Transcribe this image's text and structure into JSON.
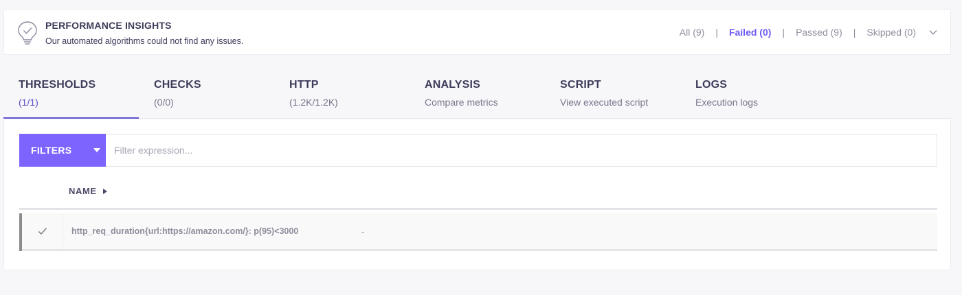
{
  "insights": {
    "title": "PERFORMANCE INSIGHTS",
    "subtitle": "Our automated algorithms could not find any issues.",
    "filters": [
      {
        "label": "All (9)",
        "active": false
      },
      {
        "label": "Failed (0)",
        "active": true
      },
      {
        "label": "Passed (9)",
        "active": false
      },
      {
        "label": "Skipped (0)",
        "active": false
      }
    ],
    "separator": "|",
    "icon": "lightbulb-check-icon",
    "expand_icon": "chevron-down-icon"
  },
  "tabs": [
    {
      "title": "THRESHOLDS",
      "sub": "(1/1)",
      "active": true
    },
    {
      "title": "CHECKS",
      "sub": "(0/0)",
      "active": false
    },
    {
      "title": "HTTP",
      "sub": "(1.2K/1.2K)",
      "active": false
    },
    {
      "title": "ANALYSIS",
      "sub": "Compare metrics",
      "active": false
    },
    {
      "title": "SCRIPT",
      "sub": "View executed script",
      "active": false
    },
    {
      "title": "LOGS",
      "sub": "Execution logs",
      "active": false
    }
  ],
  "filterbar": {
    "button_label": "FILTERS",
    "placeholder": "Filter expression..."
  },
  "table": {
    "column_name": "NAME",
    "rows": [
      {
        "status_icon": "checkmark-icon",
        "name": "http_req_duration{url:https://amazon.com/}: p(95)<3000",
        "value": "-"
      }
    ]
  },
  "colors": {
    "accent": "#7d64ff",
    "active_filter": "#6e5bf2",
    "tab_underline": "#5c4fc9"
  }
}
